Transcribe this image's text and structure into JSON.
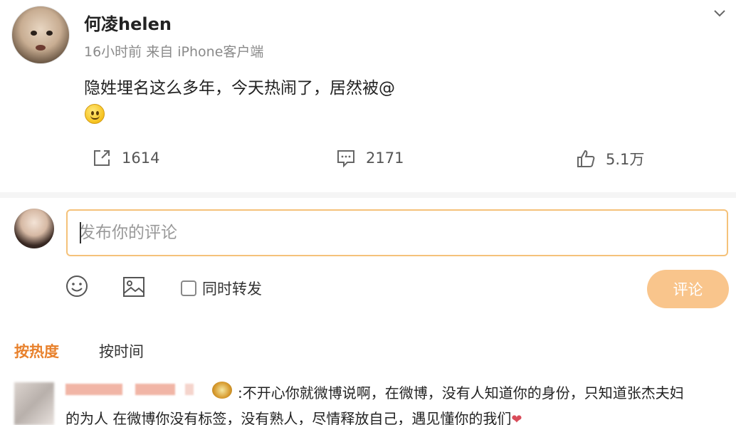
{
  "post": {
    "author": "何凌helen",
    "meta": "16小时前 来自 iPhone客户端",
    "text": "隐姓埋名这么多年，今天热闹了，居然被@",
    "emoji": "smile-emoji",
    "actions": {
      "repost_count": "1614",
      "comment_count": "2171",
      "like_count": "5.1万"
    }
  },
  "composer": {
    "placeholder": "发布你的评论",
    "repost_label": "同时转发",
    "submit_label": "评论"
  },
  "sort": {
    "hot": "按热度",
    "time": "按时间"
  },
  "comment": {
    "line1": ":不开心你就微博说啊，在微博，没有人知道你的身份，只知道张杰夫妇",
    "line2": "的为人  在微博你没有标签，没有熟人，尽情释放自己，遇见懂你的我们"
  },
  "colors": {
    "accent": "#e8812c",
    "input_border": "#f5c27a",
    "submit_bg": "#f9c58c"
  }
}
